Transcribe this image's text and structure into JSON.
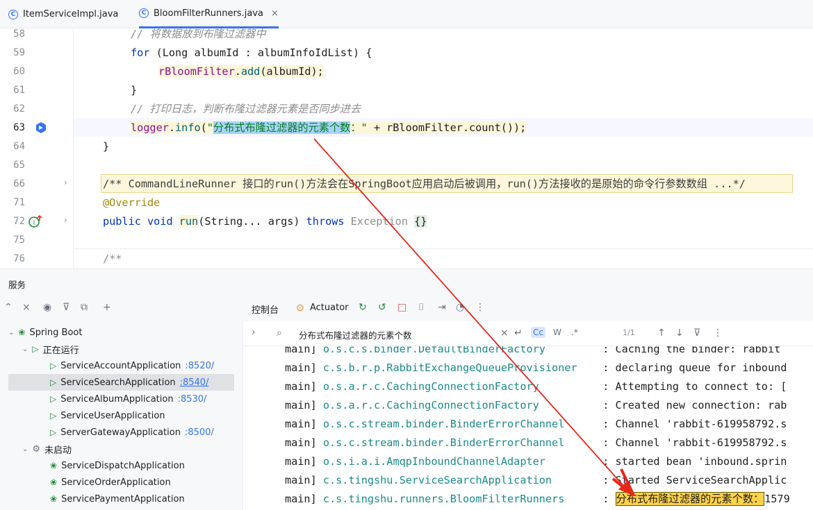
{
  "tabs": [
    {
      "label": "ItemServiceImpl.java",
      "icon": "class-icon"
    },
    {
      "label": "BloomFilterRunners.java",
      "icon": "class-icon",
      "close": "×"
    }
  ],
  "editor": {
    "line_numbers": [
      "58",
      "59",
      "60",
      "61",
      "62",
      "63",
      "64",
      "65",
      "66",
      "71",
      "72",
      "75",
      "76"
    ],
    "lines": {
      "l58": "// 将数据放到布隆过滤器中",
      "l59_kw": "for",
      "l59_a": " (Long albumId : albumInfoIdList) {",
      "l60_var": "rBloomFilter",
      "l60_dot": ".",
      "l60_fn": "add",
      "l60_rest": "(albumId);",
      "l61": "}",
      "l62": "// 打印日志，判断布隆过滤器元素是否同步进去",
      "l63_var": "logger",
      "l63_dot": ".",
      "l63_fn": "info",
      "l63_p": "(",
      "l63_q": "\"",
      "l63_sel": "分布式布隆过滤器的元素个数",
      "l63_str2": "：\"",
      "l63_rest": " + rBloomFilter.count());",
      "l64": "}",
      "l66": "/** CommandLineRunner 接口的run()方法会在SpringBoot应用启动后被调用，run()方法接收的是原始的命令行参数数组 ...*/",
      "l71": "@Override",
      "l72_kw1": "public",
      "l72_kw2": "void",
      "l72_fn": "run",
      "l72_a": "(String... args) ",
      "l72_kw3": "throws",
      "l72_b": " Exception ",
      "l72_c": "{}",
      "l76": "/**"
    }
  },
  "services": {
    "title": "服务",
    "tree": {
      "root": "Spring Boot",
      "running_group": "正在运行",
      "running": [
        {
          "name": "ServiceAccountApplication",
          "port": ":8520/"
        },
        {
          "name": "ServiceSearchApplication",
          "port": ":8540/"
        },
        {
          "name": "ServiceAlbumApplication",
          "port": ":8530/"
        },
        {
          "name": "ServiceUserApplication",
          "port": ""
        },
        {
          "name": "ServerGatewayApplication",
          "port": ":8500/"
        }
      ],
      "stopped_group": "未启动",
      "stopped": [
        {
          "name": "ServiceDispatchApplication"
        },
        {
          "name": "ServiceOrderApplication"
        },
        {
          "name": "ServicePaymentApplication"
        }
      ]
    }
  },
  "console": {
    "tab_console": "控制台",
    "tab_actuator": "Actuator",
    "search_value": "分布式布隆过滤器的元素个数",
    "match_count": "1/1",
    "opt_case": "Cc",
    "opt_word": "W",
    "opt_regex": ".*",
    "logs": [
      {
        "thread": "main]",
        "logger": "o.s.c.s.binder.DefaultBinderFactory",
        "msg": ": Caching the binder: rabbit"
      },
      {
        "thread": "main]",
        "logger": "c.s.b.r.p.RabbitExchangeQueueProvisioner",
        "msg": ": declaring queue for inbound"
      },
      {
        "thread": "main]",
        "logger": "o.s.a.r.c.CachingConnectionFactory",
        "msg": ": Attempting to connect to: ["
      },
      {
        "thread": "main]",
        "logger": "o.s.a.r.c.CachingConnectionFactory",
        "msg": ": Created new connection: rab"
      },
      {
        "thread": "main]",
        "logger": "o.s.c.stream.binder.BinderErrorChannel",
        "msg": ": Channel 'rabbit-619958792.s"
      },
      {
        "thread": "main]",
        "logger": "o.s.c.stream.binder.BinderErrorChannel",
        "msg": ": Channel 'rabbit-619958792.s"
      },
      {
        "thread": "main]",
        "logger": "o.s.i.a.i.AmqpInboundChannelAdapter",
        "msg": ": started bean 'inbound.sprin"
      },
      {
        "thread": "main]",
        "logger": "c.s.tingshu.ServiceSearchApplication",
        "msg": ": Started ServiceSearchApplic"
      },
      {
        "thread": "main]",
        "logger": "c.s.tingshu.runners.BloomFilterRunners",
        "msg_pre": ": ",
        "msg_hl": "分布式布隆过滤器的元素个数：",
        "msg_post": "1579"
      }
    ]
  },
  "colors": {
    "accent": "#3574f0",
    "running": "#208a3c",
    "arrow": "#e8261a",
    "match": "#ffd24a"
  }
}
